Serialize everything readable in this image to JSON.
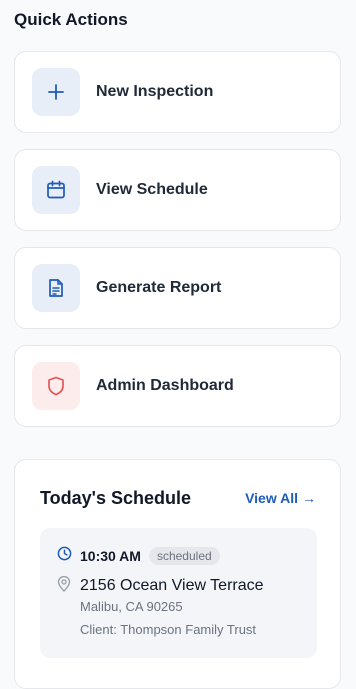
{
  "quick_actions": {
    "title": "Quick Actions",
    "items": [
      {
        "label": "New Inspection",
        "icon": "plus-icon",
        "tone": "blue"
      },
      {
        "label": "View Schedule",
        "icon": "calendar-icon",
        "tone": "blue"
      },
      {
        "label": "Generate Report",
        "icon": "document-icon",
        "tone": "blue"
      },
      {
        "label": "Admin Dashboard",
        "icon": "shield-icon",
        "tone": "red"
      }
    ]
  },
  "schedule": {
    "title": "Today's Schedule",
    "view_all": "View All",
    "view_all_arrow": "→",
    "appointment": {
      "time": "10:30 AM",
      "status": "scheduled",
      "address": "2156 Ocean View Terrace",
      "city": "Malibu, CA 90265",
      "client": "Client: Thompson Family Trust"
    }
  },
  "colors": {
    "accent": "#1e5bb8",
    "danger": "#e25555",
    "icon_bg_blue": "#e8eef8",
    "icon_bg_red": "#fdecec"
  }
}
